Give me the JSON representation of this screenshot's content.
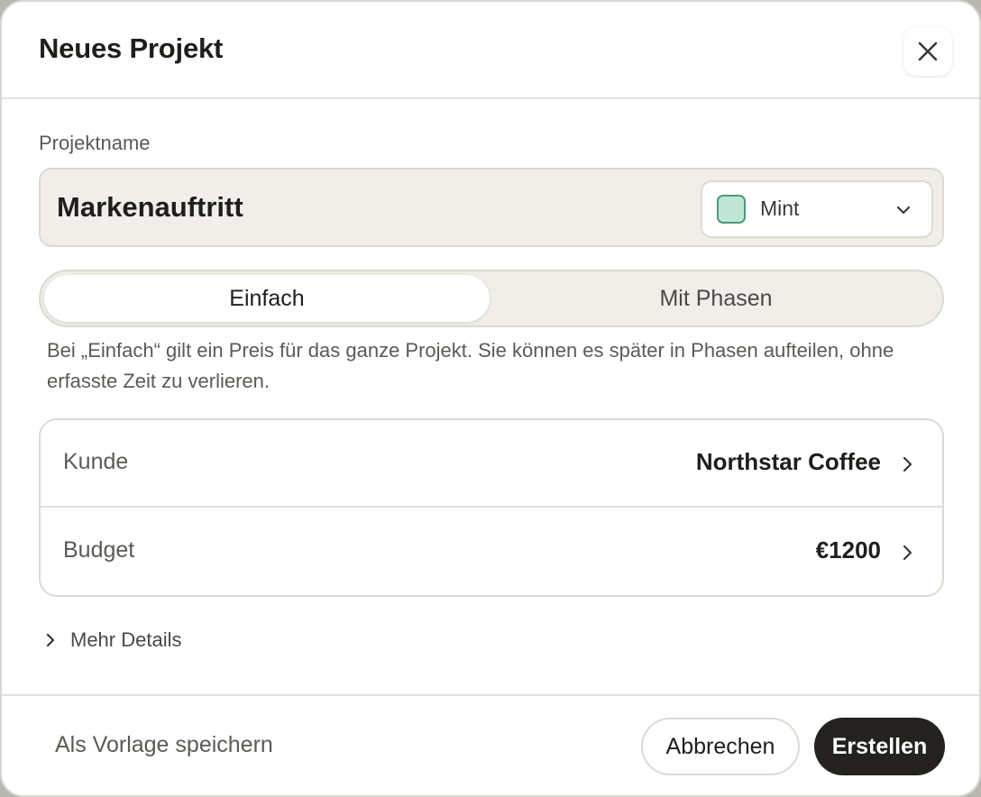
{
  "dialog": {
    "title": "Neues Projekt",
    "close_icon": "close-icon"
  },
  "project_name": {
    "label": "Projektname",
    "value": "Markenauftritt"
  },
  "color_select": {
    "selected": "Mint",
    "swatch_color": "#bfe6d5",
    "icon": "chevron-down-icon"
  },
  "mode": {
    "options": [
      "Einfach",
      "Mit Phasen"
    ],
    "selected": "Einfach",
    "hint": "Bei „Einfach“ gilt ein Preis für das ganze Projekt. Sie können es später in Phasen aufteilen, ohne erfasste Zeit zu verlieren."
  },
  "details": {
    "rows": [
      {
        "label": "Kunde",
        "value": "Northstar Coffee"
      },
      {
        "label": "Budget",
        "value": "€1200"
      }
    ],
    "more_label": "Mehr Details"
  },
  "footer": {
    "template_label": "Als Vorlage speichern",
    "cancel_label": "Abbrechen",
    "create_label": "Erstellen"
  },
  "colors": {
    "primary_button": "#24221f",
    "field_background": "#f0eee9",
    "border": "#dcdad3"
  }
}
